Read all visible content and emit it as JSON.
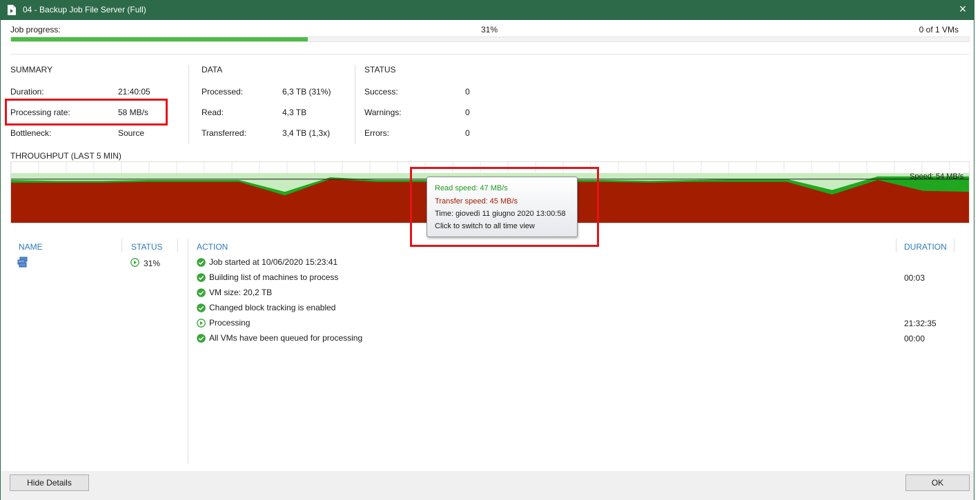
{
  "window": {
    "title": "04 - Backup Job File Server (Full)",
    "icon": "job-document-icon",
    "close_icon": "close-icon",
    "close_glyph": "×"
  },
  "progress": {
    "label": "Job progress:",
    "percent_text": "31%",
    "vms_text": "0 of 1 VMs",
    "fraction": 0.31
  },
  "summary": {
    "heading": "SUMMARY",
    "rows": [
      {
        "label": "Duration:",
        "value": "21:40:05"
      },
      {
        "label": "Processing rate:",
        "value": "58 MB/s"
      },
      {
        "label": "Bottleneck:",
        "value": "Source"
      }
    ]
  },
  "data_section": {
    "heading": "DATA",
    "rows": [
      {
        "label": "Processed:",
        "value": "6,3 TB (31%)"
      },
      {
        "label": "Read:",
        "value": "4,3 TB"
      },
      {
        "label": "Transferred:",
        "value": "3,4 TB (1,3x)"
      }
    ]
  },
  "status_section": {
    "heading": "STATUS",
    "rows": [
      {
        "label": "Success:",
        "value": "0"
      },
      {
        "label": "Warnings:",
        "value": "0"
      },
      {
        "label": "Errors:",
        "value": "0"
      }
    ]
  },
  "throughput": {
    "heading": "THROUGHPUT (LAST 5 MIN)",
    "speed_label": "Speed: 54 MB/s",
    "colors": {
      "read": "#1fa81f",
      "read_light": "#c8ecc0",
      "transfer": "#a31e00",
      "grid": "#e6e6e6"
    },
    "read_series": [
      47,
      46,
      46,
      47,
      47,
      47,
      34,
      50,
      47,
      47,
      46,
      48,
      47,
      47,
      46,
      47,
      48,
      48,
      36,
      51,
      51,
      51
    ],
    "transfer_series": [
      44,
      44,
      44,
      45,
      45,
      45,
      30,
      48,
      45,
      45,
      44,
      46,
      45,
      45,
      44,
      45,
      45,
      45,
      31,
      47,
      35,
      34
    ],
    "max": 60,
    "tooltip": {
      "read": "Read speed: 47 MB/s",
      "transfer": "Transfer speed: 45 MB/s",
      "time": "Time: giovedì 11 giugno 2020 13:00:58",
      "hint": "Click to switch to all time view"
    }
  },
  "vm_list": {
    "col_name": "NAME",
    "col_status": "STATUS",
    "vm_icon": "vm-server-icon",
    "status_icon": "play-circle-icon",
    "status_text": "31%"
  },
  "actions": {
    "col_action": "ACTION",
    "col_duration": "DURATION",
    "rows": [
      {
        "icon": "check-circle-icon",
        "text": "Job started at 10/06/2020 15:23:41",
        "duration": ""
      },
      {
        "icon": "check-circle-icon",
        "text": "Building list of machines to process",
        "duration": "00:03"
      },
      {
        "icon": "check-circle-icon",
        "text": "VM size: 20,2 TB",
        "duration": ""
      },
      {
        "icon": "check-circle-icon",
        "text": "Changed block tracking is enabled",
        "duration": ""
      },
      {
        "icon": "play-circle-icon",
        "text": "Processing",
        "duration": "21:32:35"
      },
      {
        "icon": "check-circle-icon",
        "text": "All VMs have been queued for processing",
        "duration": "00:00"
      }
    ]
  },
  "buttons": {
    "hide_details": "Hide Details",
    "ok": "OK"
  },
  "colors": {
    "titlebar": "#2d6a4a",
    "progress": "#4cbb47",
    "header_blue": "#2f7ab8",
    "highlight_red": "#e3141b"
  }
}
